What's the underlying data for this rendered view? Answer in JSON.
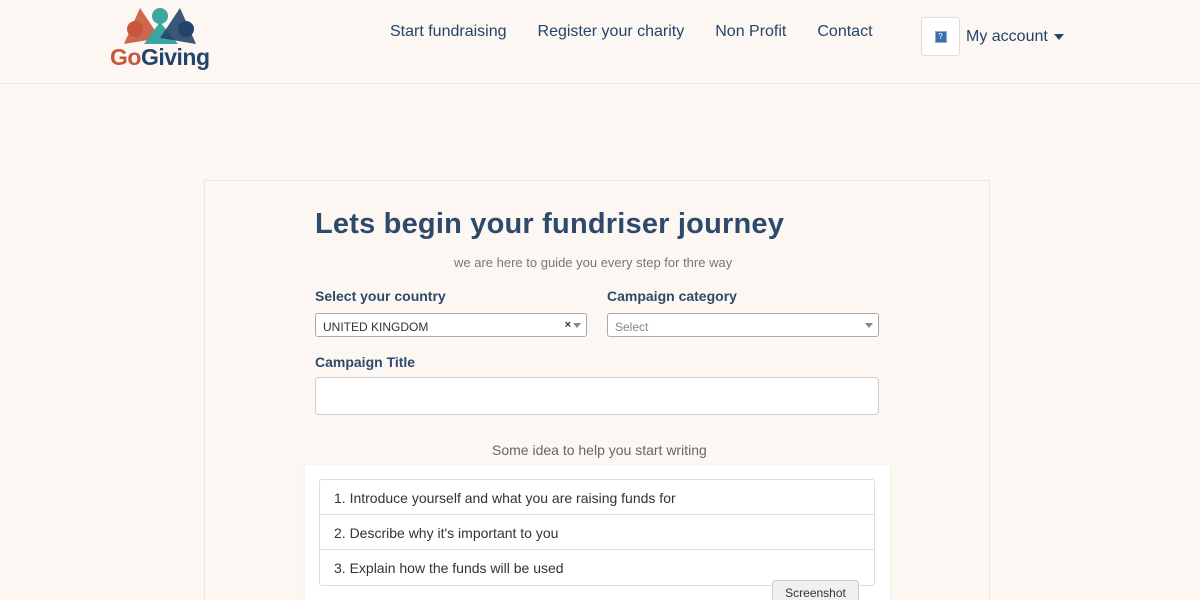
{
  "header": {
    "logo": {
      "go": "Go",
      "giving": "Giving"
    },
    "nav": [
      {
        "label": "Start fundraising"
      },
      {
        "label": "Register your charity"
      },
      {
        "label": "Non Profit"
      },
      {
        "label": "Contact"
      }
    ],
    "account": {
      "label": "My account",
      "avatar_glyph": "?"
    }
  },
  "form": {
    "title": "Lets begin your fundriser journey",
    "subtitle": "we are here to guide you every step for thre way",
    "country": {
      "label": "Select your country",
      "value": "UNITED KINGDOM",
      "clear_glyph": "×"
    },
    "category": {
      "label": "Campaign category",
      "placeholder": "Select"
    },
    "campaign_title": {
      "label": "Campaign Title",
      "value": ""
    },
    "ideas": {
      "heading": "Some idea to help you start writing",
      "items": [
        "1. Introduce yourself and what you are raising funds for",
        "2. Describe why it's important to you",
        "3. Explain how the funds will be used"
      ]
    }
  },
  "overlay": {
    "screenshot_label": "Screenshot"
  },
  "colors": {
    "brand_orange": "#c9573b",
    "brand_navy": "#25446a",
    "brand_teal": "#3aa6a0",
    "background": "#fcf7f2"
  }
}
